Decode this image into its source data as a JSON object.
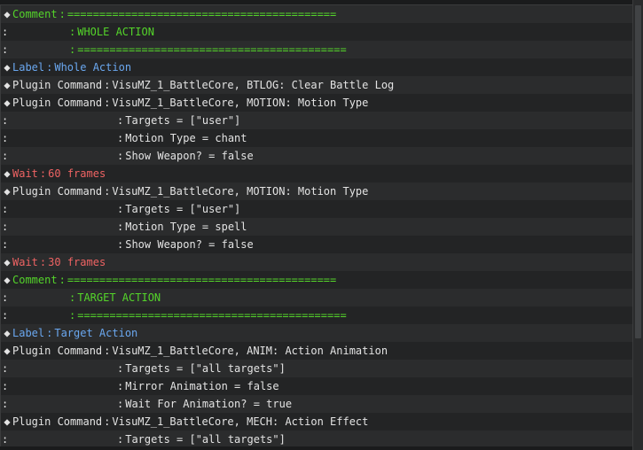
{
  "colors": {
    "comment": "#54d42a",
    "label": "#6aa7ef",
    "wait": "#ee6363",
    "default": "#e3e3e3"
  },
  "rows": [
    {
      "kind": "comment",
      "marker": "◆",
      "cat": "Comment",
      "text": "=========================================="
    },
    {
      "kind": "comment-cont",
      "marker": ":",
      "cat": "",
      "text": "WHOLE ACTION"
    },
    {
      "kind": "comment-cont",
      "marker": ":",
      "cat": "",
      "text": "=========================================="
    },
    {
      "kind": "label",
      "marker": "◆",
      "cat": "Label",
      "text": "Whole Action"
    },
    {
      "kind": "plugin",
      "marker": "◆",
      "cat": "Plugin Command",
      "text": "VisuMZ_1_BattleCore, BTLOG: Clear Battle Log"
    },
    {
      "kind": "plugin",
      "marker": "◆",
      "cat": "Plugin Command",
      "text": "VisuMZ_1_BattleCore, MOTION: Motion Type"
    },
    {
      "kind": "plugin-cont",
      "marker": ":",
      "cat": "",
      "text": "Targets = [\"user\"]"
    },
    {
      "kind": "plugin-cont",
      "marker": ":",
      "cat": "",
      "text": "Motion Type = chant"
    },
    {
      "kind": "plugin-cont",
      "marker": ":",
      "cat": "",
      "text": "Show Weapon? = false"
    },
    {
      "kind": "wait",
      "marker": "◆",
      "cat": "Wait",
      "text": "60 frames"
    },
    {
      "kind": "plugin",
      "marker": "◆",
      "cat": "Plugin Command",
      "text": "VisuMZ_1_BattleCore, MOTION: Motion Type"
    },
    {
      "kind": "plugin-cont",
      "marker": ":",
      "cat": "",
      "text": "Targets = [\"user\"]"
    },
    {
      "kind": "plugin-cont",
      "marker": ":",
      "cat": "",
      "text": "Motion Type = spell"
    },
    {
      "kind": "plugin-cont",
      "marker": ":",
      "cat": "",
      "text": "Show Weapon? = false"
    },
    {
      "kind": "wait",
      "marker": "◆",
      "cat": "Wait",
      "text": "30 frames"
    },
    {
      "kind": "comment",
      "marker": "◆",
      "cat": "Comment",
      "text": "=========================================="
    },
    {
      "kind": "comment-cont",
      "marker": ":",
      "cat": "",
      "text": "TARGET ACTION"
    },
    {
      "kind": "comment-cont",
      "marker": ":",
      "cat": "",
      "text": "=========================================="
    },
    {
      "kind": "label",
      "marker": "◆",
      "cat": "Label",
      "text": "Target Action"
    },
    {
      "kind": "plugin",
      "marker": "◆",
      "cat": "Plugin Command",
      "text": "VisuMZ_1_BattleCore, ANIM: Action Animation"
    },
    {
      "kind": "plugin-cont",
      "marker": ":",
      "cat": "",
      "text": "Targets = [\"all targets\"]"
    },
    {
      "kind": "plugin-cont",
      "marker": ":",
      "cat": "",
      "text": "Mirror Animation = false"
    },
    {
      "kind": "plugin-cont",
      "marker": ":",
      "cat": "",
      "text": "Wait For Animation? = true"
    },
    {
      "kind": "plugin",
      "marker": "◆",
      "cat": "Plugin Command",
      "text": "VisuMZ_1_BattleCore, MECH: Action Effect"
    },
    {
      "kind": "plugin-cont",
      "marker": ":",
      "cat": "",
      "text": "Targets = [\"all targets\"]"
    }
  ]
}
